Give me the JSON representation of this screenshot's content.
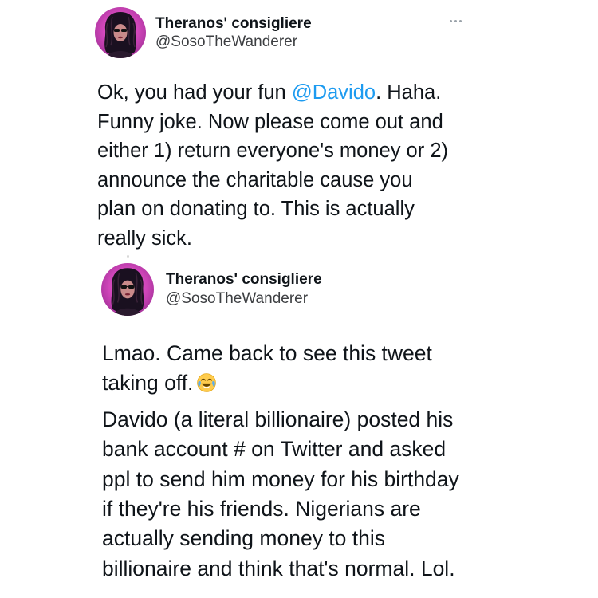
{
  "tweet1": {
    "author_name": "Theranos' consigliere",
    "author_handle": "@SosoTheWanderer",
    "more_icon": "more-dots-icon",
    "text_lines": [
      {
        "before": "Ok, you had your fun ",
        "mention": "@Davido",
        "after": ". Haha."
      },
      "Funny joke. Now please come out and",
      "either 1) return everyone's money or 2)",
      "announce the charitable cause you",
      "plan on donating to. This is actually",
      "really sick."
    ],
    "colors": {
      "mention": "#1d9bf0",
      "avatar": "#e14fc6"
    }
  },
  "tweet2": {
    "author_name": "Theranos' consigliere",
    "author_handle": "@SosoTheWanderer",
    "paragraph1_lines": [
      "Lmao. Came back to see this tweet",
      "taking off."
    ],
    "emoji": "face-with-tears-of-joy-icon",
    "paragraph2_lines": [
      "Davido (a literal billionaire) posted his",
      "bank account # on Twitter and asked",
      "ppl to send him money for his birthday",
      "if they're his friends. Nigerians are",
      "actually sending money to this",
      "billionaire and think that's normal. Lol."
    ]
  }
}
